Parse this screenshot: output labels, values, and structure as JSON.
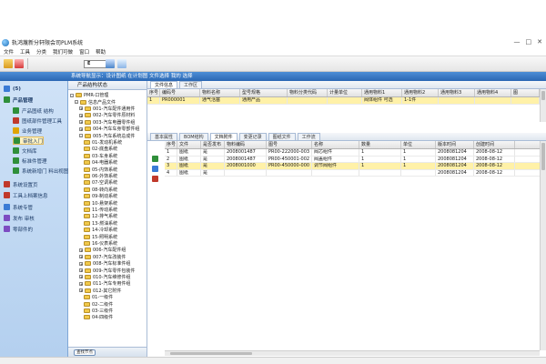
{
  "window": {
    "title": "轨鸿蔑新分轩限会司PLM系统",
    "controls": [
      "—",
      "□",
      "✕"
    ]
  },
  "menu": [
    "文件",
    "工具",
    "分类",
    "我们可做",
    "窗口",
    "帮助"
  ],
  "toolbar": {
    "field_value": "E"
  },
  "topband": {
    "text": "系统导航显示：设计图纸 在计划图 文件选择 我的 选择"
  },
  "left_nav": {
    "items": [
      {
        "label": "(5)",
        "icon": "home-icon",
        "color": "#3a7bd5"
      },
      {
        "label": "产品管理",
        "icon": "product-icon",
        "color": "#2f8f3a"
      },
      {
        "label": "产品图纸 结构",
        "icon": "drawing-icon",
        "color": "#2f8f3a"
      },
      {
        "label": "图纸部件管理工具",
        "icon": "parts-icon",
        "color": "#c0392b"
      },
      {
        "label": "业务管理",
        "icon": "business-icon",
        "color": "#e0a400"
      },
      {
        "label": "审批入门",
        "icon": "approve-icon",
        "color": "#2f8f3a"
      },
      {
        "label": "文档库",
        "icon": "docs-icon",
        "color": "#2f8f3a"
      },
      {
        "label": "标准件管理",
        "icon": "standard-icon",
        "color": "#2f8f3a"
      },
      {
        "label": "系统新增门 料出视图",
        "icon": "view-icon",
        "color": "#2f8f3a"
      },
      {
        "label": "系统设置页",
        "icon": "settings-icon",
        "color": "#c0392b"
      },
      {
        "label": "工具上档案信息",
        "icon": "tools-icon",
        "color": "#c0392b"
      },
      {
        "label": "系统专管",
        "icon": "system-icon",
        "color": "#3a7bd5"
      },
      {
        "label": "发布 审核",
        "icon": "release-icon",
        "color": "#7d4cc2"
      },
      {
        "label": "零部件的",
        "icon": "part-icon",
        "color": "#7d4cc2"
      }
    ]
  },
  "tree": {
    "header": "产品结构状态",
    "items": [
      {
        "label": "PMR-口管理",
        "level": 0,
        "exp": "-"
      },
      {
        "label": "信息产品文件",
        "level": 1,
        "exp": "-"
      },
      {
        "label": "001-汽车配件通用件",
        "level": 2,
        "exp": "+"
      },
      {
        "label": "002-汽车零件原材料",
        "level": 2,
        "exp": "+"
      },
      {
        "label": "003-汽车电器零件组",
        "level": 2,
        "exp": "+"
      },
      {
        "label": "004-汽车车身零部件组",
        "level": 2,
        "exp": "+"
      },
      {
        "label": "005-汽车系统总成件",
        "level": 2,
        "exp": "-"
      },
      {
        "label": "01-发动机系统",
        "level": 3,
        "exp": ""
      },
      {
        "label": "02-底盘系统",
        "level": 3,
        "exp": ""
      },
      {
        "label": "03-车身系统",
        "level": 3,
        "exp": ""
      },
      {
        "label": "04-电器系统",
        "level": 3,
        "exp": ""
      },
      {
        "label": "05-内饰系统",
        "level": 3,
        "exp": ""
      },
      {
        "label": "06-外饰系统",
        "level": 3,
        "exp": ""
      },
      {
        "label": "07-空调系统",
        "level": 3,
        "exp": ""
      },
      {
        "label": "08-转向系统",
        "level": 3,
        "exp": ""
      },
      {
        "label": "09-制动系统",
        "level": 3,
        "exp": ""
      },
      {
        "label": "10-悬架系统",
        "level": 3,
        "exp": ""
      },
      {
        "label": "11-传动系统",
        "level": 3,
        "exp": ""
      },
      {
        "label": "12-排气系统",
        "level": 3,
        "exp": ""
      },
      {
        "label": "13-燃油系统",
        "level": 3,
        "exp": ""
      },
      {
        "label": "14-冷却系统",
        "level": 3,
        "exp": ""
      },
      {
        "label": "15-照明系统",
        "level": 3,
        "exp": ""
      },
      {
        "label": "16-仪表系统",
        "level": 3,
        "exp": ""
      },
      {
        "label": "006-汽车配件组",
        "level": 2,
        "exp": "+"
      },
      {
        "label": "007-汽车改装件",
        "level": 2,
        "exp": "+"
      },
      {
        "label": "008-汽车标准件组",
        "level": 2,
        "exp": "+"
      },
      {
        "label": "009-汽车零件包装件",
        "level": 2,
        "exp": "+"
      },
      {
        "label": "010-汽车维修件组",
        "level": 2,
        "exp": "+"
      },
      {
        "label": "011-汽车专用件组",
        "level": 2,
        "exp": "+"
      },
      {
        "label": "012-其它附件",
        "level": 2,
        "exp": "+"
      },
      {
        "label": "01-一级件",
        "level": 3,
        "exp": ""
      },
      {
        "label": "02-二级件",
        "level": 3,
        "exp": ""
      },
      {
        "label": "03-三级件",
        "level": 3,
        "exp": ""
      },
      {
        "label": "04-四级件",
        "level": 3,
        "exp": ""
      }
    ],
    "footer_button": "查找节点"
  },
  "top_tabs": [
    "文件信息",
    "工作区"
  ],
  "top_grid": {
    "columns": [
      "序号",
      "编码号",
      "物料名称",
      "型号规格",
      "物料分类代码",
      "计量单位",
      "通用物料1",
      "通用物料2",
      "通用物料3",
      "通用物料4",
      "图"
    ],
    "rows": [
      [
        "1",
        "PR000001",
        "通气活塞",
        "通用产品",
        "",
        "",
        "阀体组件 可选",
        "1-1件",
        "",
        "",
        ""
      ]
    ]
  },
  "bottom_tabs": [
    "基本属性",
    "BOM结构",
    "文档附件",
    "变更记录",
    "图纸文件",
    "工作流"
  ],
  "bottom_grid": {
    "columns": [
      "序号",
      "文件",
      "是否发布",
      "物料编码",
      "图号",
      "名称",
      "数量",
      "单位",
      "版本时间",
      "创建时间"
    ],
    "rows": [
      [
        "1",
        "图纸",
        "是",
        "2008001487",
        "PR00-222000-003",
        "阀芯组件",
        "1",
        "1",
        "2008081204",
        "2008-08-12"
      ],
      [
        "2",
        "图纸",
        "是",
        "2008001487",
        "PR00-450001-002",
        "阀盖组件",
        "1",
        "1",
        "2008081204",
        "2008-08-12"
      ],
      [
        "3",
        "图纸",
        "是",
        "2008001000",
        "PR00-450000-000",
        "调节阀组件",
        "1",
        "1",
        "2008081204",
        "2008-08-12"
      ],
      [
        "4",
        "图纸",
        "是",
        "",
        "",
        "",
        "",
        "",
        "2008081204",
        "2008-08-12"
      ]
    ]
  },
  "colors": {
    "band": "#2a67b3",
    "selected_row": "#fff1a8",
    "nav_bg": "#cfe2f7"
  }
}
